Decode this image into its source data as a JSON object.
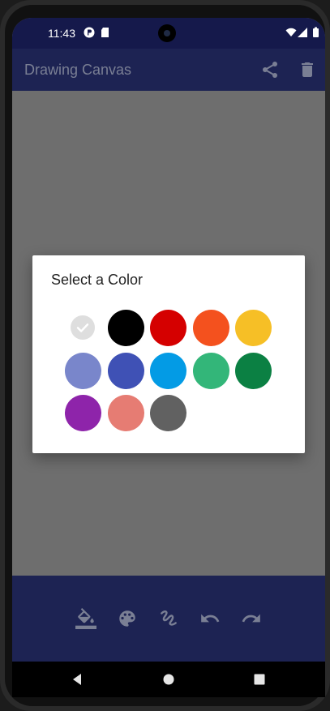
{
  "status_bar": {
    "time": "11:43",
    "left_icons": [
      "p-icon",
      "sd-card-icon"
    ],
    "right_icons": [
      "wifi-icon",
      "signal-icon",
      "battery-icon"
    ]
  },
  "app_bar": {
    "title": "Drawing Canvas",
    "actions": [
      "share-icon",
      "delete-icon"
    ]
  },
  "dialog": {
    "title": "Select a Color",
    "selected_index": 0,
    "colors": [
      "#dedede",
      "#000000",
      "#d50000",
      "#f4511e",
      "#f6bf26",
      "#7986cb",
      "#3f51b5",
      "#039be5",
      "#33b679",
      "#0b8043",
      "#8e24aa",
      "#e67c73",
      "#616161"
    ],
    "check_icon": "check-icon"
  },
  "bottom_bar": {
    "tools": [
      "fill-icon",
      "palette-icon",
      "brush-icon",
      "undo-icon",
      "redo-icon"
    ],
    "icon_color": "#7a7f94"
  },
  "nav_bar": {
    "buttons": [
      "back-icon",
      "home-icon",
      "recents-icon"
    ]
  }
}
